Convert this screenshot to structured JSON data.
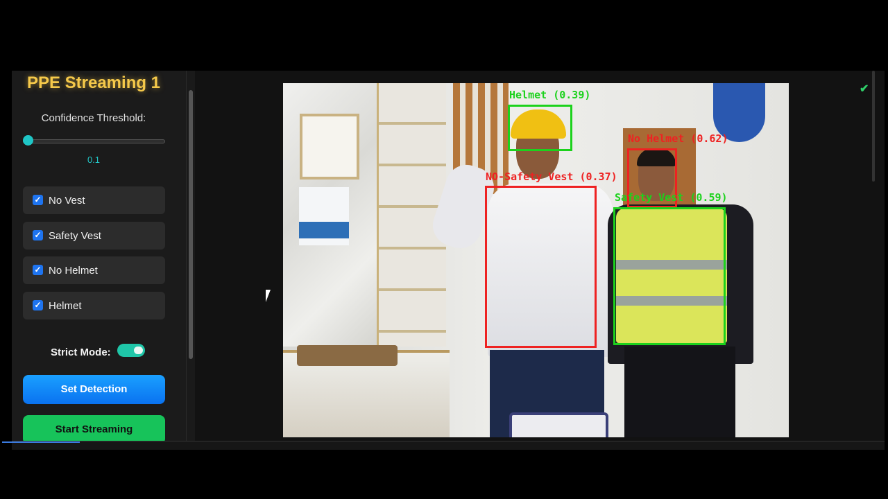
{
  "sidebar": {
    "title": "PPE Streaming 1",
    "confidence_label": "Confidence Threshold:",
    "confidence_value": "0.1",
    "confidence_fraction": 0.0,
    "filters": [
      {
        "label": "No Vest",
        "checked": true
      },
      {
        "label": "Safety Vest",
        "checked": true
      },
      {
        "label": "No Helmet",
        "checked": true
      },
      {
        "label": "Helmet",
        "checked": true
      }
    ],
    "strict_mode_label": "Strict Mode:",
    "strict_mode_on": true,
    "set_detection_label": "Set Detection",
    "start_streaming_label": "Start Streaming"
  },
  "detections": [
    {
      "label": "Helmet (0.39)",
      "color": "green"
    },
    {
      "label": "No Helmet (0.62)",
      "color": "red"
    },
    {
      "label": "NO-Safety Vest (0.37)",
      "color": "red"
    },
    {
      "label": "Safety Vest (0.59)",
      "color": "green"
    }
  ],
  "status": {
    "icon": "check-icon"
  },
  "colors": {
    "title": "#f5c94a",
    "accent": "#1fc6c6",
    "button_blue": "#0a72f0",
    "button_green": "#17c35a",
    "box_green": "#1cd21c",
    "box_red": "#ee2222"
  }
}
